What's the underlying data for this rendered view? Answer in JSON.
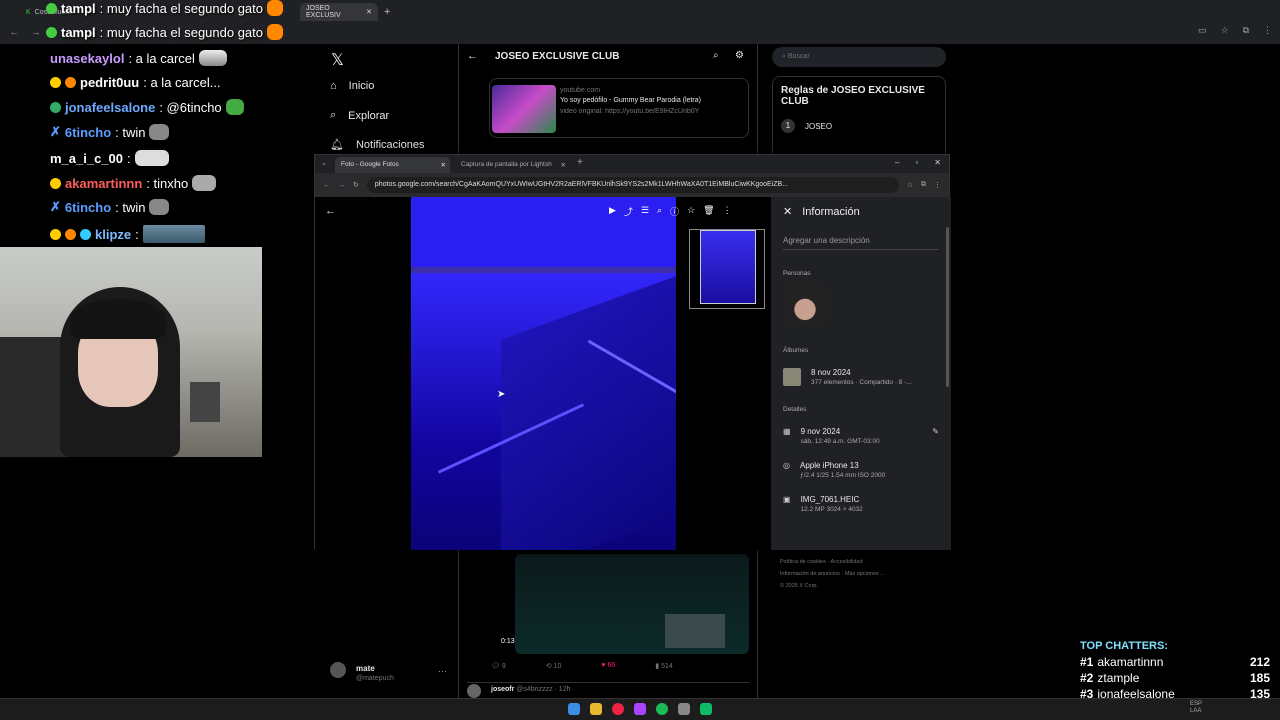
{
  "browser": {
    "tab_partial": "Cosculluela",
    "tab_active": "JOSEO EXCLUSIV"
  },
  "chat": [
    {
      "user": "tampl",
      "msg": ": muy facha el segundo gato",
      "color": "#ffffff"
    },
    {
      "user": "tampl",
      "msg": ": muy facha el segundo gato",
      "color": "#ffffff"
    },
    {
      "user": "unasekaylol",
      "msg": ": a la carcel",
      "color": "#c89bff"
    },
    {
      "user": "pedrit0uu",
      "msg": ": a la carcel...",
      "color": "#ffffff"
    },
    {
      "user": "jonafeelsalone",
      "msg": ": @6tincho",
      "color": "#6fa8ff"
    },
    {
      "user": "6tincho",
      "msg": ": twin",
      "color": "#5b9dff"
    },
    {
      "user": "m_a_i_c_00",
      "msg": ":",
      "color": "#ffffff"
    },
    {
      "user": "akamartinnn",
      "msg": ": tinxho",
      "color": "#ff5c5c"
    },
    {
      "user": "6tincho",
      "msg": ": twin",
      "color": "#5b9dff"
    },
    {
      "user": "klipze",
      "msg": ":",
      "color": "#7fb8ff"
    }
  ],
  "x_nav": {
    "home": "Inicio",
    "explore": "Explorar",
    "notifications": "Notificaciones"
  },
  "x_header": {
    "title": "JOSEO EXCLUSIVE CLUB"
  },
  "x_card": {
    "domain": "youtube.com",
    "title": "Yo soy pedófilo - Gummy Bear Parodia (letra)",
    "desc": "video original: https://youtu.be/E9lHZcUnb0Y"
  },
  "x_search_placeholder": "Buscar",
  "x_rules": {
    "title": "Reglas de JOSEO EXCLUSIVE CLUB",
    "rule1_num": "1",
    "rule1": "JOSEO"
  },
  "x_video": {
    "time": "0:13"
  },
  "x_post_stats": {
    "replies": "9",
    "reposts": "10",
    "likes": "66",
    "views": "514"
  },
  "x_next_post": {
    "user": "joseofr",
    "handle": "@s4brizzzz · 12h"
  },
  "x_account": {
    "name": "mate",
    "handle": "@matepuch"
  },
  "x_footer": [
    "Política de cookies",
    "Accesibilidad",
    "Información de anuncios",
    "Más opciones ...",
    "© 2025 X Corp."
  ],
  "window": {
    "tab1": "Foto - Google Fotos",
    "tab2": "Captura de pantalla por Lightsh",
    "url": "photos.google.com/search/CgAaKAomQUYxUWIwUGtHV2R2aERlVFBKUnlhSk9YS2s2Mk1LWHhWaXA0T1EiMBluCiwKKgooEiZB..."
  },
  "info": {
    "title": "Información",
    "desc_placeholder": "Agregar una descripción",
    "people_label": "Personas",
    "albums_label": "Álbumes",
    "album_date": "8 nov 2024",
    "album_meta": "377 elementos · Compartido · 8 -...",
    "details_label": "Detalles",
    "date": "9 nov 2024",
    "date_meta": "sáb, 12:49 a.m.   GMT-03:00",
    "camera": "Apple iPhone 13",
    "camera_meta": "ƒ/2.4   1/25   1.54 mm   ISO 2000",
    "file": "IMG_7061.HEIC",
    "file_meta": "12.2 MP   3024 × 4032"
  },
  "top_chatters": {
    "title": "TOP CHATTERS:",
    "rows": [
      {
        "rank": "#1",
        "name": "akamartinnn",
        "count": "212"
      },
      {
        "rank": "#2",
        "name": "ztample",
        "count": "185"
      },
      {
        "rank": "#3",
        "name": "jonafeelsalone",
        "count": "135"
      }
    ]
  },
  "taskbar": {
    "lang1": "ESP",
    "lang2": "LAA"
  }
}
